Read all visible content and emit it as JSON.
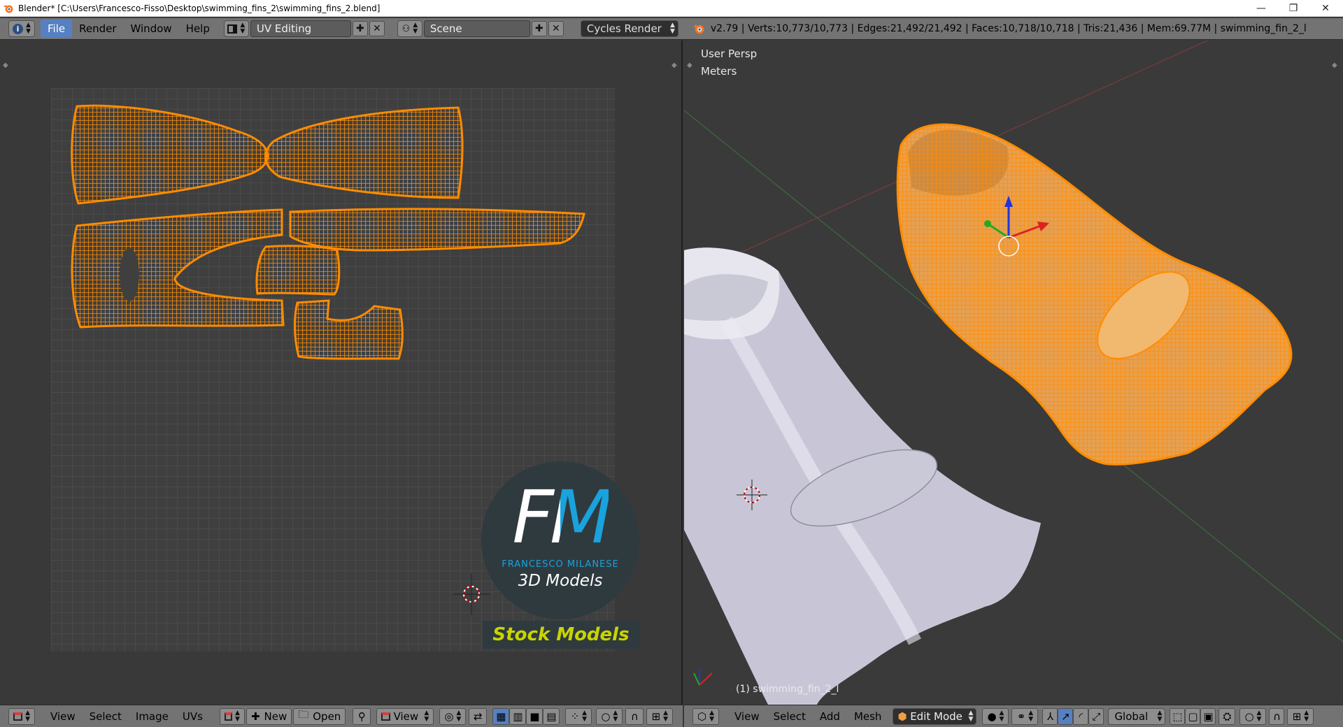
{
  "window": {
    "title": "Blender* [C:\\Users\\Francesco-Fisso\\Desktop\\swimming_fins_2\\swimming_fins_2.blend]",
    "minimize": "—",
    "restore": "❐",
    "close": "✕"
  },
  "info_header": {
    "menus": [
      "File",
      "Render",
      "Window",
      "Help"
    ],
    "screen_layout": "UV Editing",
    "scene": "Scene",
    "render_engine": "Cycles Render",
    "stats": "v2.79 | Verts:10,773/10,773 | Edges:21,492/21,492 | Faces:10,718/10,718 | Tris:21,436 | Mem:69.77M | swimming_fin_2_l"
  },
  "viewport": {
    "persp_label": "User Persp",
    "units_label": "Meters",
    "object_label": "(1) swimming_fin_2_l"
  },
  "watermark": {
    "fm": "FM",
    "name": "FRANCESCO MILANESE",
    "subtitle": "3D Models",
    "stock": "Stock Models"
  },
  "uv_header": {
    "menus": [
      "View",
      "Select",
      "Image",
      "UVs"
    ],
    "new_label": "New",
    "open_label": "Open",
    "view_label": "View"
  },
  "view3d_header": {
    "menus": [
      "View",
      "Select",
      "Add",
      "Mesh"
    ],
    "mode": "Edit Mode",
    "orientation": "Global"
  },
  "colors": {
    "accent": "#5680c2",
    "selection": "#ff8c00",
    "header_bg": "#737373",
    "editor_bg": "#393939"
  }
}
